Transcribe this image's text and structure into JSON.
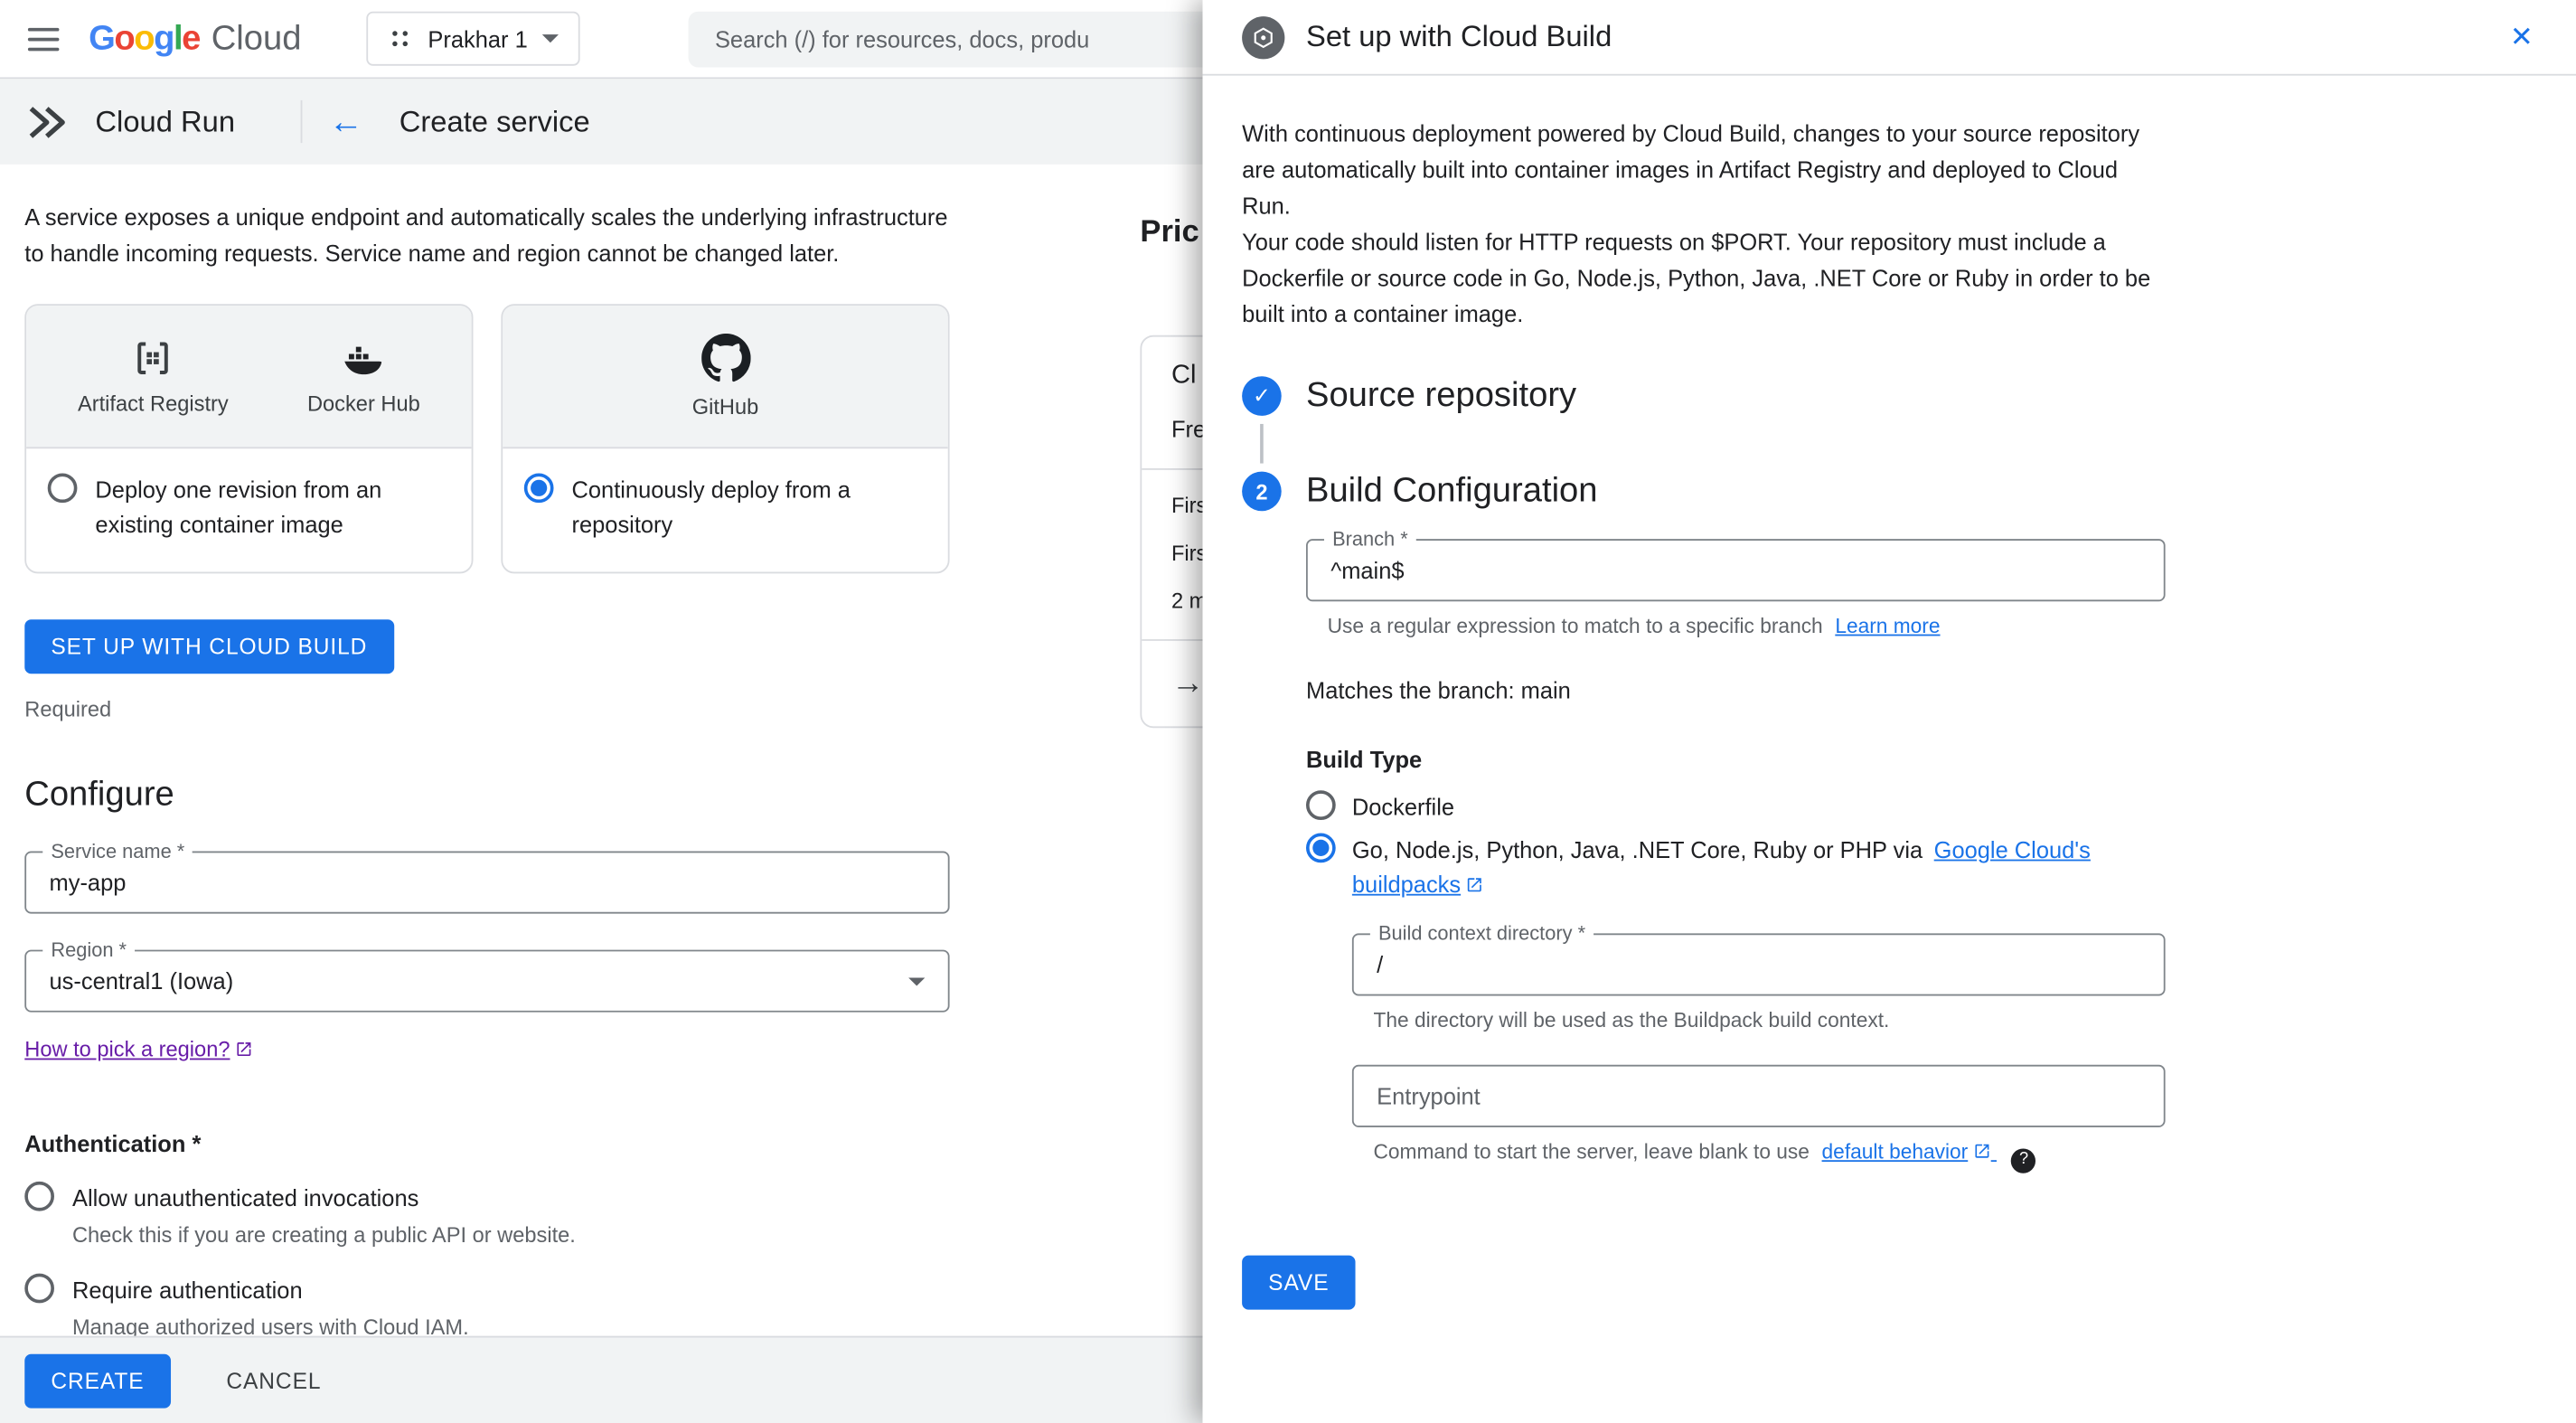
{
  "colors": {
    "accent_blue": "#1a73e8",
    "text_primary": "#202124",
    "text_secondary": "#5f6368",
    "border_grey": "#dadce0",
    "field_border": "#80868b",
    "bar_grey": "#f1f3f4",
    "link_visited_purple": "#681da8",
    "google_blue": "#4285F4",
    "google_red": "#EA4335",
    "google_yellow": "#FBBC05",
    "google_green": "#34A853"
  },
  "icons": {
    "menu": "hamburger-menu",
    "close": "✕",
    "back_arrow": "←",
    "forward_arrow": "→",
    "check": "✓",
    "help": "?",
    "step2_number": "2"
  },
  "topbar": {
    "logo": {
      "l1": "G",
      "l2": "o",
      "l3": "o",
      "l4": "g",
      "l5": "l",
      "l6": "e",
      "cloud": "Cloud"
    },
    "project_name": "Prakhar 1",
    "search_placeholder": "Search (/) for resources, docs, produ"
  },
  "subheader": {
    "product": "Cloud Run",
    "title": "Create service"
  },
  "main": {
    "intro": "A service exposes a unique endpoint and automatically scales the underlying infrastructure to handle incoming requests. Service name and region cannot be changed later.",
    "card_container": {
      "source1": "Artifact Registry",
      "source2": "Docker Hub",
      "radio_label": "Deploy one revision from an existing container image"
    },
    "card_repo": {
      "source1": "GitHub",
      "radio_label": "Continuously deploy from a repository"
    },
    "setup_button": "SET UP WITH CLOUD BUILD",
    "required": "Required",
    "configure_heading": "Configure",
    "service_name": {
      "label": "Service name *",
      "value": "my-app"
    },
    "region": {
      "label": "Region *",
      "value": "us-central1 (Iowa)",
      "link": "How to pick a region?"
    },
    "auth": {
      "heading": "Authentication *",
      "options": [
        {
          "label": "Allow unauthenticated invocations",
          "desc": "Check this if you are creating a public API or website."
        },
        {
          "label": "Require authentication",
          "desc": "Manage authorized users with Cloud IAM."
        }
      ]
    },
    "create_button": "CREATE",
    "cancel_button": "CANCEL"
  },
  "pricing": {
    "heading": "Pric",
    "card_title": "Cl",
    "subtitle": "Fre",
    "row1": "Firs",
    "row2": "Firs",
    "row3": "2 m"
  },
  "panel": {
    "title": "Set up with Cloud Build",
    "para1": "With continuous deployment powered by Cloud Build, changes to your source repository are automatically built into container images in Artifact Registry and deployed to Cloud Run.",
    "para2": "Your code should listen for HTTP requests on $PORT. Your repository must include a Dockerfile or source code in Go, Node.js, Python, Java, .NET Core or Ruby in order to be built into a container image.",
    "step1_title": "Source repository",
    "step2_title": "Build Configuration",
    "branch": {
      "label": "Branch *",
      "value": "^main$",
      "helper": "Use a regular expression to match to a specific branch",
      "helper_link": "Learn more"
    },
    "matches_text": "Matches the branch: main",
    "build_type_heading": "Build Type",
    "option_dockerfile": "Dockerfile",
    "option_buildpacks_prefix": "Go, Node.js, Python, Java, .NET Core, Ruby or PHP via",
    "option_buildpacks_link": "Google Cloud's buildpacks",
    "context_dir": {
      "label": "Build context directory *",
      "value": "/",
      "helper": "The directory will be used as the Buildpack build context."
    },
    "entrypoint": {
      "placeholder": "Entrypoint",
      "helper_prefix": "Command to start the server, leave blank to use",
      "helper_link": "default behavior"
    },
    "save_button": "SAVE"
  }
}
